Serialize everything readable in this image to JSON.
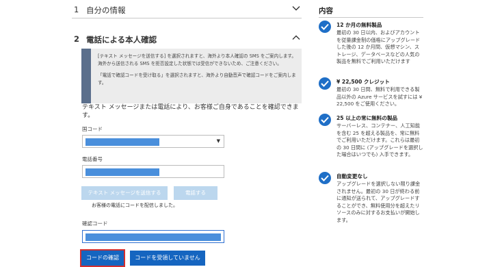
{
  "steps": [
    {
      "number": "1",
      "title": "自分の情報"
    },
    {
      "number": "2",
      "title": "電話による本人確認"
    }
  ],
  "notice": {
    "p1": "[テキスト メッセージを送信する] を選択されますと、海外より本人確認の SMS をご案内します。海外から送信される SMS を拒否設定した状態では受信ができないため、ご注意ください。",
    "p2": "「電話で確認コードを受け取る」を選択されますと、海外より自動音声で確認コードをご案内します。"
  },
  "intro": "テキスト メッセージまたは電話により、お客様ご自身であることを確認できます。",
  "form": {
    "country_label": "国コード",
    "phone_label": "電話番号",
    "send_text_label": "テキスト メッセージを送信する",
    "call_label": "電話する",
    "sent_note": "お客様の電話にコードを配信しました。",
    "code_label": "確認コード",
    "confirm_label": "コードの確認",
    "not_received_label": "コードを受領していません"
  },
  "sidebar": {
    "title": "内容",
    "benefits": [
      {
        "name": "12 か月の無料製品",
        "desc": "最初の 30 日以内、およびアカウントを従量課金制の価格にアップグレードした後の 12 か月間、仮想マシン、ストレージ、データベースなどの人気の製品を無料でご利用いただけます"
      },
      {
        "name": "¥ 22,500 クレジット",
        "desc": "最初の 30 日間、無料で利用できる製品以外の Azure サービスを試すには ¥ 22,500 をご使用ください。"
      },
      {
        "name": "25 以上の常に無料の製品",
        "desc": "サーバーレス、コンテナー、人工知能を含む 25 を超える製品を、常に無料でご利用いただけます。これらは最初の 30 日間に (アップグレードを選択した場合はいつでも) 入手できます。"
      },
      {
        "name": "自動変更なし",
        "desc": "アップグレードを選択しない限り課金されません。最初の 30 日が終わる前に通知が送られて、アップグレードすることができ、無料使用分を超えたリソースのみに対するお支払いが開始します。"
      }
    ]
  },
  "colors": {
    "accent": "#1565c0",
    "check": "#1f6fc7",
    "masked_value": "#4a8fdc",
    "focus_outline": "#d32f2f"
  },
  "icons": {
    "step_toggle": "chevron",
    "benefit": "checkmark-circle",
    "select": "dropdown-caret"
  }
}
